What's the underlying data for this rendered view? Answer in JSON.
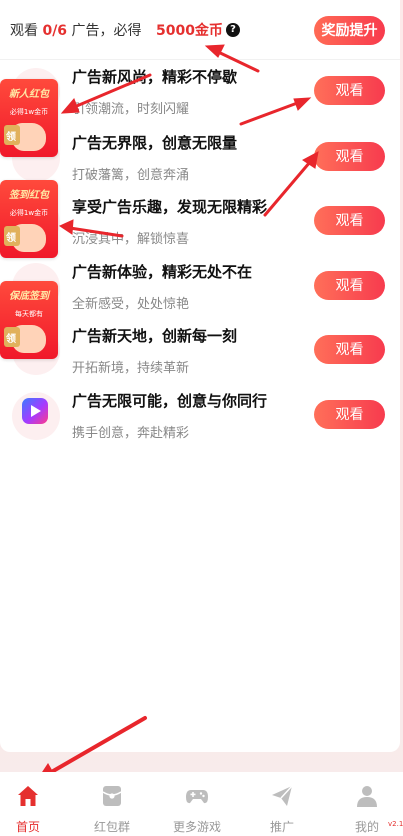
{
  "header": {
    "watch_prefix": "观看",
    "watch_count": "0/6",
    "watch_middle": "广告，必得",
    "coin_text": "5000金币",
    "help_symbol": "?",
    "reward_button": "奖励提升"
  },
  "ad_list": [
    {
      "title": "广告新风尚，精彩不停歇",
      "subtitle": "引领潮流，时刻闪耀",
      "button": "观看"
    },
    {
      "title": "广告无界限，创意无限量",
      "subtitle": "打破藩篱，创意奔涌",
      "button": "观看"
    },
    {
      "title": "享受广告乐趣，发现无限精彩",
      "subtitle": "沉浸其中，解锁惊喜",
      "button": "观看"
    },
    {
      "title": "广告新体验，精彩无处不在",
      "subtitle": "全新感受，处处惊艳",
      "button": "观看"
    },
    {
      "title": "广告新天地，创新每一刻",
      "subtitle": "开拓新境，持续革新",
      "button": "观看"
    },
    {
      "title": "广告无限可能，创意与你同行",
      "subtitle": "携手创意，奔赴精彩",
      "button": "观看"
    }
  ],
  "promos": [
    {
      "title": "新人红包",
      "subtitle": "必得1w金币"
    },
    {
      "title": "签到红包",
      "subtitle": "必得1w金币"
    },
    {
      "title": "保底签到",
      "subtitle": "每天都有"
    }
  ],
  "tabs": [
    {
      "label": "首页",
      "icon": "home-icon",
      "active": true
    },
    {
      "label": "红包群",
      "icon": "red-packet-icon",
      "active": false
    },
    {
      "label": "更多游戏",
      "icon": "gamepad-icon",
      "active": false
    },
    {
      "label": "推广",
      "icon": "paper-plane-icon",
      "active": false
    },
    {
      "label": "我的",
      "icon": "user-icon",
      "active": false
    }
  ],
  "version_text": "v2.1",
  "colors": {
    "accent": "#e5302f",
    "button_gradient_start": "#ff6f59",
    "button_gradient_end": "#f73b4e",
    "annotation_arrow": "#e8262c"
  }
}
